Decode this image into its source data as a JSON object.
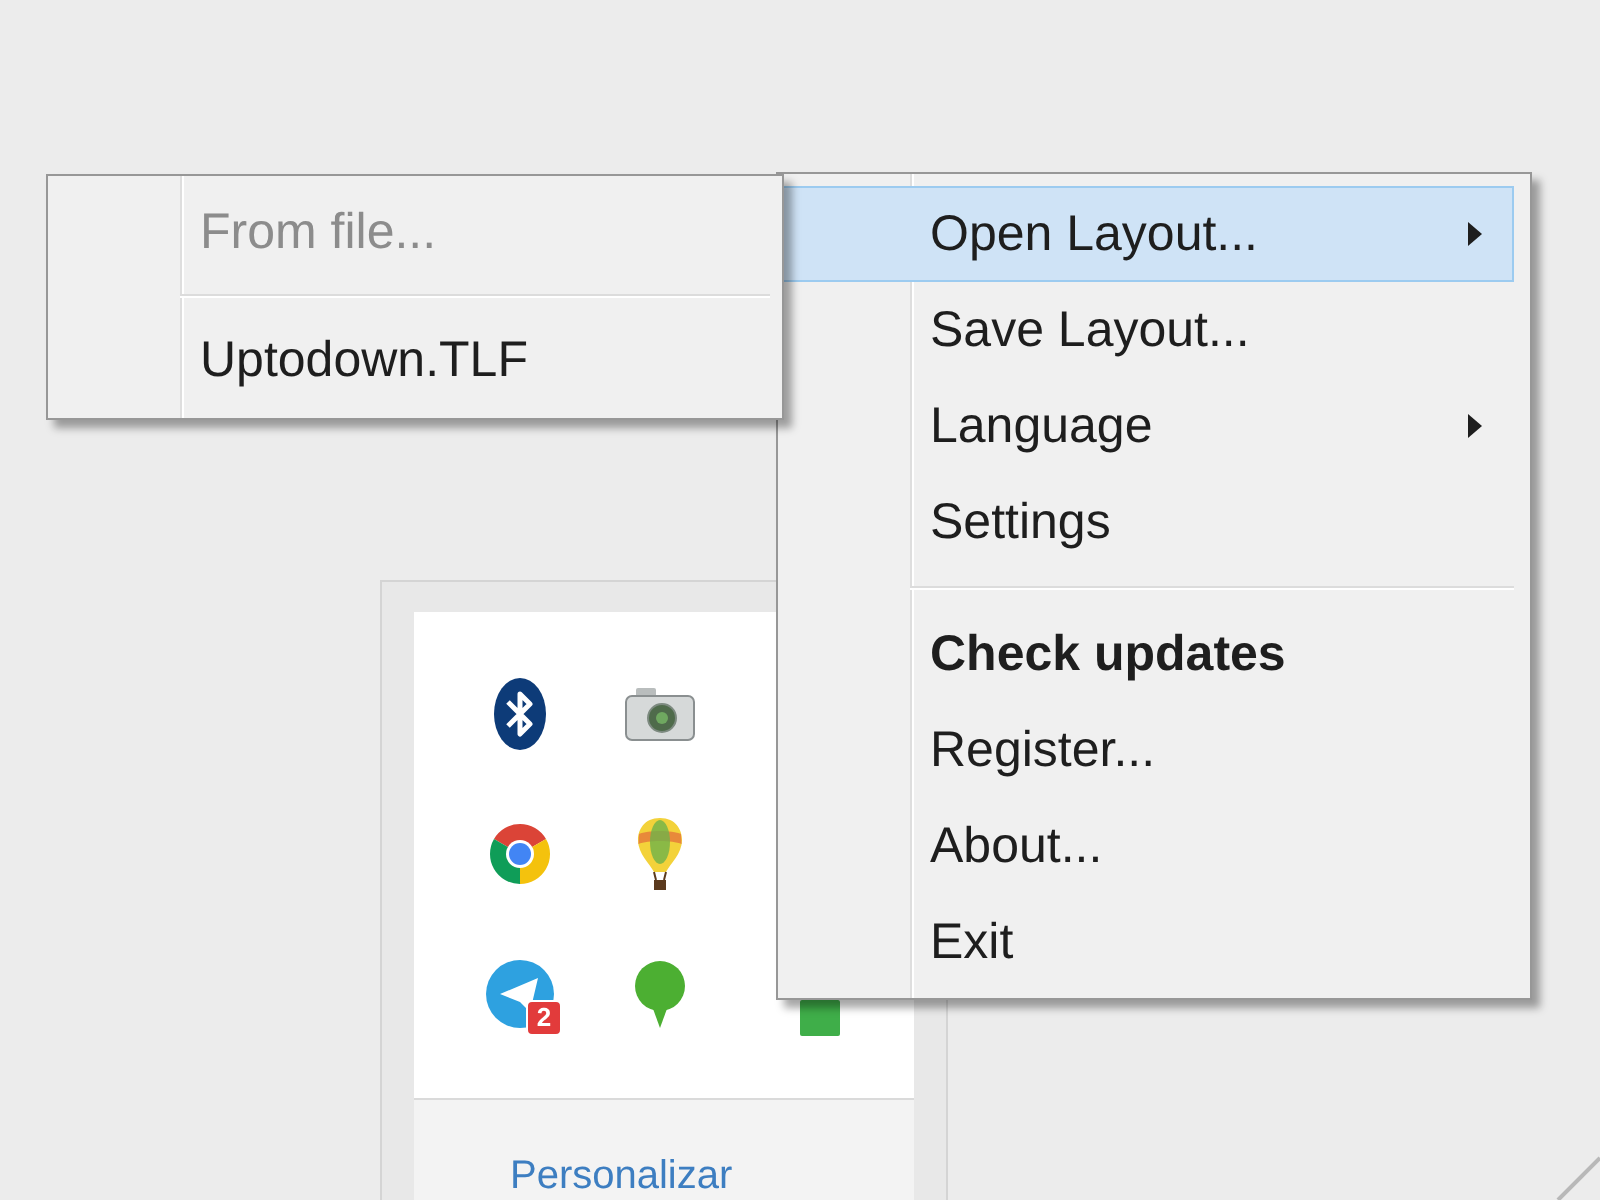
{
  "tray": {
    "rows": [
      [
        {
          "kind": "bluetooth"
        },
        {
          "kind": "camera"
        }
      ],
      [
        {
          "kind": "chrome"
        },
        {
          "kind": "balloon"
        }
      ],
      [
        {
          "kind": "messenger",
          "badge": "2"
        },
        {
          "kind": "speech"
        },
        {
          "kind": "tile"
        }
      ]
    ],
    "link": "Personalizar"
  },
  "menu": {
    "items": [
      {
        "kind": "item",
        "label": "Open Layout...",
        "selected": true,
        "has_submenu": true,
        "default": false
      },
      {
        "kind": "item",
        "label": "Save Layout...",
        "selected": false,
        "has_submenu": false,
        "default": false
      },
      {
        "kind": "item",
        "label": "Language",
        "selected": false,
        "has_submenu": true,
        "default": false
      },
      {
        "kind": "item",
        "label": "Settings",
        "selected": false,
        "has_submenu": false,
        "default": false
      },
      {
        "kind": "separator"
      },
      {
        "kind": "item",
        "label": "Check updates",
        "selected": false,
        "has_submenu": false,
        "default": true
      },
      {
        "kind": "item",
        "label": "Register...",
        "selected": false,
        "has_submenu": false,
        "default": false
      },
      {
        "kind": "item",
        "label": "About...",
        "selected": false,
        "has_submenu": false,
        "default": false
      },
      {
        "kind": "item",
        "label": "Exit",
        "selected": false,
        "has_submenu": false,
        "default": false
      }
    ]
  },
  "submenu": {
    "items": [
      {
        "kind": "item",
        "label": "From file...",
        "disabled": true
      },
      {
        "kind": "separator"
      },
      {
        "kind": "item",
        "label": "Uptodown.TLF",
        "disabled": false
      }
    ]
  }
}
